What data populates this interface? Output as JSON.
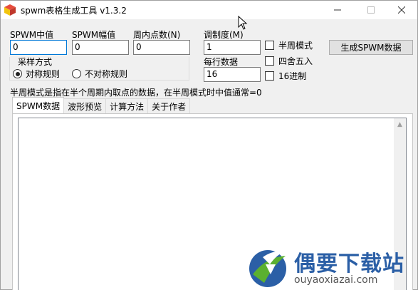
{
  "window": {
    "title": "spwm表格生成工具 v1.3.2",
    "icons": {
      "app": "app-cube-icon",
      "minimize": "minimize-icon",
      "maximize": "maximize-icon",
      "close": "close-icon"
    }
  },
  "inputs": {
    "center_label": "SPWM中值",
    "center_value": "0",
    "amplitude_label": "SPWM幅值",
    "amplitude_value": "0",
    "points_label": "周内点数(N)",
    "points_value": "0",
    "modulation_label": "调制度(M)",
    "modulation_value": "1",
    "per_row_label": "每行数据",
    "per_row_value": "16"
  },
  "sampling": {
    "label": "采样方式",
    "options": [
      {
        "label": "对称规则",
        "selected": true
      },
      {
        "label": "不对称规则",
        "selected": false
      }
    ]
  },
  "checkboxes": [
    {
      "label": "半周模式",
      "checked": false
    },
    {
      "label": "四舍五入",
      "checked": false
    },
    {
      "label": "16进制",
      "checked": false
    }
  ],
  "generate_button": "生成SPWM数据",
  "hint": "半周模式是指在半个周期内取点的数据，在半周模式时中值通常=0",
  "tabs": [
    {
      "label": "SPWM数据",
      "active": true
    },
    {
      "label": "波形预览",
      "active": false
    },
    {
      "label": "计算方法",
      "active": false
    },
    {
      "label": "关于作者",
      "active": false
    }
  ],
  "output_text": "",
  "watermark": {
    "brand": "偶要下载站",
    "url": "ouyaoxiazai.com",
    "colors": {
      "blue": "#2b5fa6",
      "green": "#5bb030"
    }
  }
}
